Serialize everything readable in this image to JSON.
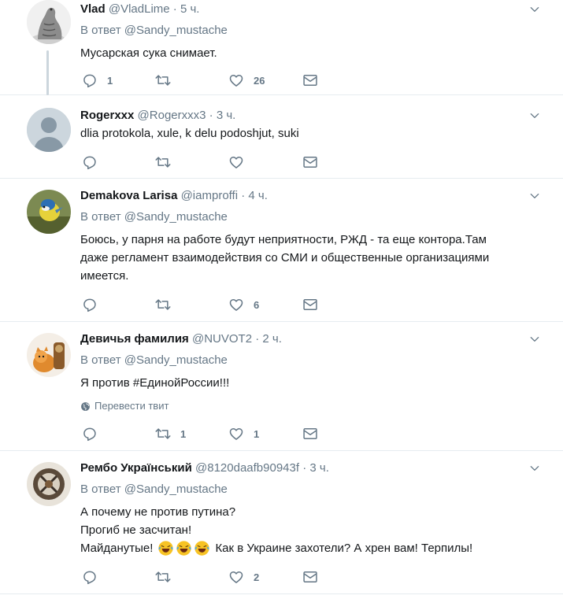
{
  "common": {
    "reply_prefix": "В ответ",
    "dot": "·"
  },
  "tweets": [
    {
      "name": "Vlad",
      "handle": "@VladLime",
      "time": "5 ч.",
      "reply_to": "@Sandy_mustache",
      "text": [
        "Мусарская сука снимает."
      ],
      "replies": "1",
      "retweets": "",
      "likes": "26"
    },
    {
      "name": "Rogerxxx",
      "handle": "@Rogerxxx3",
      "time": "3 ч.",
      "text": [
        "dlia protokola, xule, k delu podoshjut, suki"
      ],
      "replies": "",
      "retweets": "",
      "likes": ""
    },
    {
      "name": "Demakova Larisa",
      "handle": "@iamproffi",
      "time": "4 ч.",
      "reply_to": "@Sandy_mustache",
      "text": [
        "Боюсь, у парня на работе будут неприятности, РЖД - та еще контора.Там",
        "даже регламент взаимодействия со СМИ и общественные организациями",
        "имеется."
      ],
      "replies": "",
      "retweets": "",
      "likes": "6"
    },
    {
      "name": "Девичья фамилия",
      "handle": "@NUVOT2",
      "time": "2 ч.",
      "reply_to": "@Sandy_mustache",
      "text": [
        "Я против #ЕдинойРоссии!!!"
      ],
      "translate": "Перевести твит",
      "replies": "",
      "retweets": "1",
      "likes": "1"
    },
    {
      "name": "Рембо Український",
      "handle": "@8120daafb90943f",
      "time": "3 ч.",
      "reply_to": "@Sandy_mustache",
      "text": [
        "А почему не против путина?",
        "Прогиб не засчитан!",
        "Майданутые!",
        "Как в Украине захотели? А хрен вам! Терпилы!"
      ],
      "emoji": [
        "face-with-tears-of-joy",
        "face-with-tears-of-joy",
        "face-with-tears-of-joy"
      ],
      "replies": "",
      "retweets": "",
      "likes": "2"
    }
  ],
  "icons": {
    "reply": "reply-icon",
    "retweet": "retweet-icon",
    "like": "heart-icon",
    "dm": "envelope-icon",
    "menu": "chevron-down-icon",
    "translate": "globe-icon"
  },
  "colors": {
    "icon": "#657786",
    "divider": "#e6ecf0",
    "name": "#14171a"
  }
}
